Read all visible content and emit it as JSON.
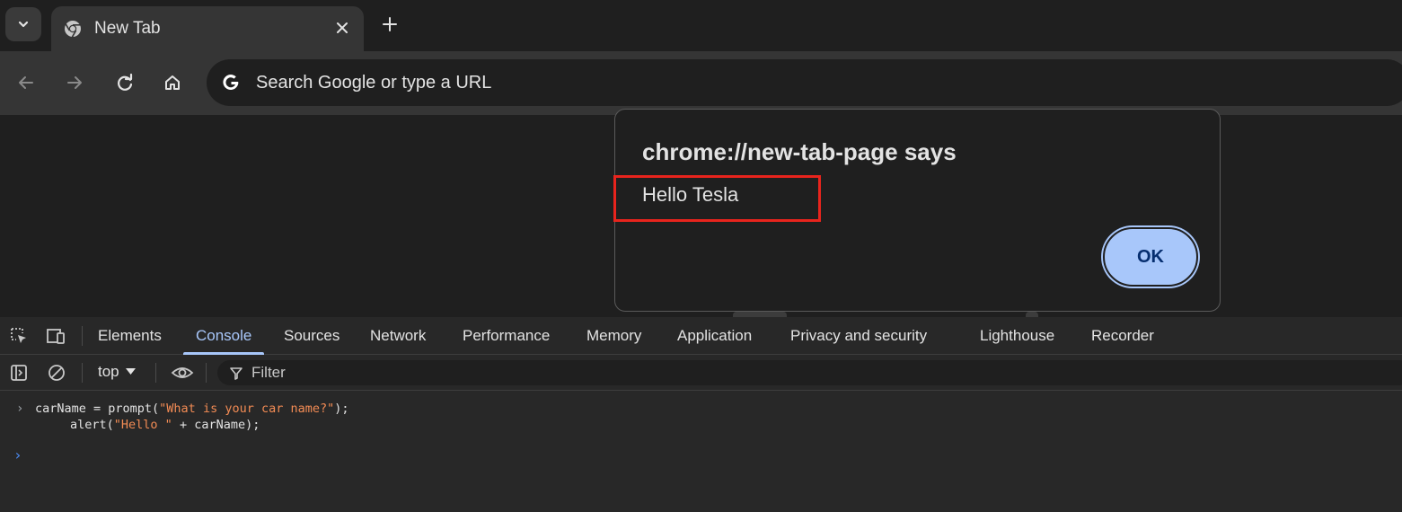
{
  "browser": {
    "tab": {
      "title": "New Tab"
    },
    "omnibox": {
      "placeholder": "Search Google or type a URL"
    }
  },
  "dialog": {
    "title": "chrome://new-tab-page says",
    "message": "Hello Tesla",
    "ok_label": "OK"
  },
  "devtools": {
    "tabs": [
      "Elements",
      "Console",
      "Sources",
      "Network",
      "Performance",
      "Memory",
      "Application",
      "Privacy and security",
      "Lighthouse",
      "Recorder"
    ],
    "active_tab": "Console",
    "context": "top",
    "filter_placeholder": "Filter",
    "console": {
      "line1": {
        "prefix": "carName = prompt(",
        "string": "\"What is your car name?\"",
        "suffix": ");"
      },
      "line2": {
        "prefix": "alert(",
        "string": "\"Hello \"",
        "suffix": " + carName);"
      }
    }
  },
  "colors": {
    "accent": "#a8c7fa",
    "highlight": "#e8241d",
    "string": "#f28b54"
  }
}
